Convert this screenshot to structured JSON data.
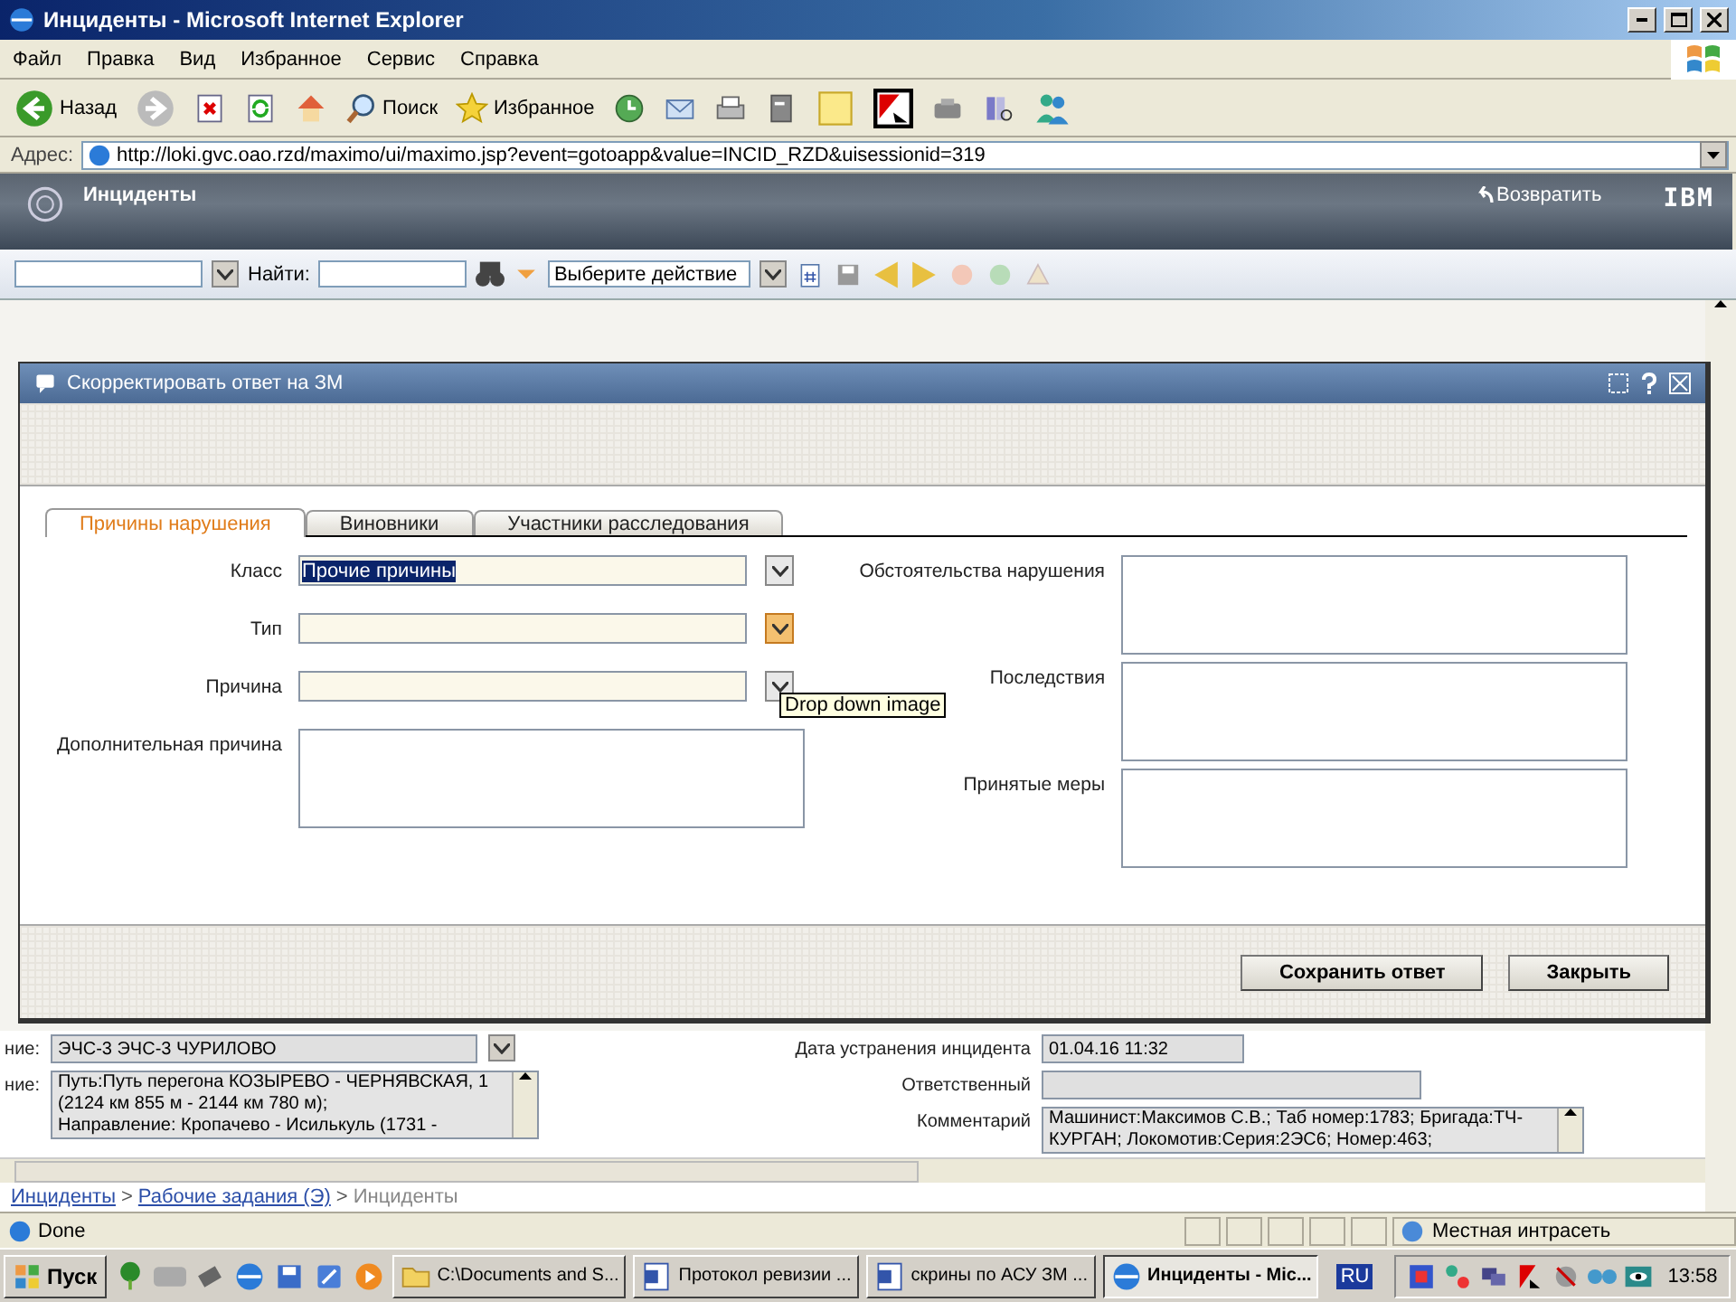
{
  "window": {
    "title": "Инциденты - Microsoft Internet Explorer"
  },
  "menu": [
    "Файл",
    "Правка",
    "Вид",
    "Избранное",
    "Сервис",
    "Справка"
  ],
  "toolbar": [
    {
      "kind": "back",
      "label": "Назад"
    },
    {
      "kind": "forward"
    },
    {
      "kind": "stop"
    },
    {
      "kind": "refresh"
    },
    {
      "kind": "home"
    },
    {
      "kind": "search",
      "label": "Поиск"
    },
    {
      "kind": "favorites",
      "label": "Избранное"
    },
    {
      "kind": "history"
    },
    {
      "kind": "mail"
    },
    {
      "kind": "print"
    },
    {
      "kind": "edit"
    },
    {
      "kind": "note"
    },
    {
      "kind": "antivirus"
    },
    {
      "kind": "tool"
    },
    {
      "kind": "research"
    },
    {
      "kind": "messenger"
    }
  ],
  "address": {
    "label": "Адрес:",
    "value": "http://loki.gvc.oao.rzd/maximo/ui/maximo.jsp?event=gotoapp&value=INCID_RZD&uisessionid=319"
  },
  "app_header": {
    "title": "Инциденты",
    "return_link": "Возвратить",
    "logo": "IBM"
  },
  "app_toolbar": {
    "find_label": "Найти:",
    "action_select": "Выберите действие"
  },
  "dialog": {
    "title": "Скорректировать ответ на ЗМ",
    "tabs": [
      {
        "label": "Причины нарушения",
        "selected": true
      },
      {
        "label": "Виновники",
        "selected": false
      },
      {
        "label": "Участники расследования",
        "selected": false
      }
    ],
    "left_fields": [
      {
        "kind": "select",
        "label": "Класс",
        "value": "Прочие причины",
        "hovered": false
      },
      {
        "kind": "select",
        "label": "Тип",
        "hovered": true
      },
      {
        "kind": "select",
        "label": "Причина",
        "hovered": false
      },
      {
        "kind": "textarea",
        "label": "Дополнительная причина"
      }
    ],
    "right_fields": [
      {
        "label": "Обстоятельства нарушения"
      },
      {
        "label": "Последствия"
      },
      {
        "label": "Принятые меры"
      }
    ],
    "tooltip": "Drop down image",
    "buttons": [
      "Сохранить ответ",
      "Закрыть"
    ]
  },
  "background_left": [
    {
      "kind": "select",
      "label": "ние:",
      "value": "ЭЧС-3 ЭЧС-3 ЧУРИЛОВО"
    },
    {
      "kind": "textarea",
      "label": "ние:",
      "lines": [
        "Путь:Путь перегона КОЗЫРЕВО - ЧЕРНЯВСКАЯ, 1",
        "(2124 км 855 м - 2144 км 780 м);",
        "Направление: Кропачево - Исилькуль (1731 -"
      ]
    }
  ],
  "background_right": [
    {
      "kind": "input",
      "label": "Дата устранения инцидента",
      "value": "01.04.16 11:32"
    },
    {
      "kind": "input",
      "label": "Ответственный"
    },
    {
      "kind": "textarea",
      "label": "Комментарий",
      "lines": [
        "Машинист:Максимов С.В.; Таб номер:1783; Бригада:ТЧ-",
        "КУРГАН; Локомотив:Серия:2ЭС6; Номер:463;"
      ]
    }
  ],
  "breadcrumb": [
    {
      "label": "Инциденты",
      "link": true
    },
    {
      "label": "Рабочие задания (Э)",
      "link": true
    },
    {
      "label": "Инциденты",
      "link": false
    }
  ],
  "breadcrumb_separator": ">",
  "status_bar": {
    "text": "Done",
    "zone": "Местная интрасеть"
  },
  "taskbar": {
    "start": "Пуск",
    "tasks": [
      {
        "kind": "folder",
        "label": "C:\\Documents and S...",
        "selected": false
      },
      {
        "kind": "word",
        "label": "Протокол ревизии ...",
        "selected": false
      },
      {
        "kind": "word",
        "label": "скрины по АСУ ЗМ ...",
        "selected": false
      },
      {
        "kind": "ie",
        "label": "Инциденты - Mic...",
        "selected": true
      }
    ],
    "language": "RU",
    "clock": "13:58"
  }
}
